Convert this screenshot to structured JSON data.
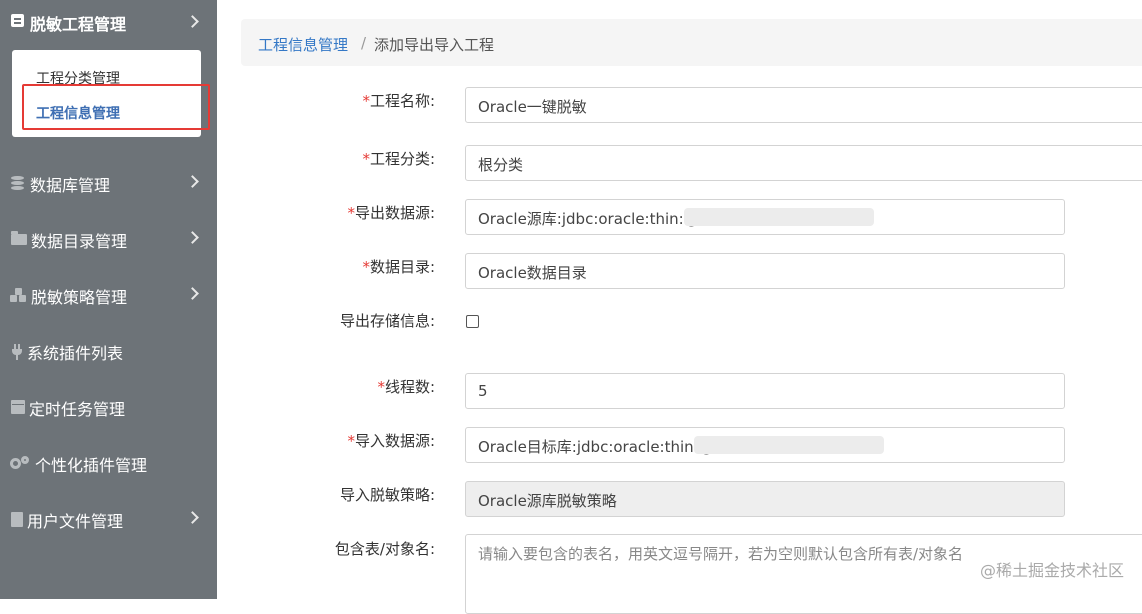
{
  "sidebar": {
    "header": {
      "title": "脱敏工程管理",
      "icon": "doc-icon"
    },
    "submenu": [
      {
        "label": "工程分类管理"
      },
      {
        "label": "工程信息管理",
        "active": true
      }
    ],
    "items": [
      {
        "label": "数据库管理",
        "icon": "database-icon",
        "has_arrow": true
      },
      {
        "label": "数据目录管理",
        "icon": "folder-icon",
        "has_arrow": true
      },
      {
        "label": "脱敏策略管理",
        "icon": "cubes-icon",
        "has_arrow": true
      },
      {
        "label": "系统插件列表",
        "icon": "plug-icon",
        "has_arrow": false
      },
      {
        "label": "定时任务管理",
        "icon": "calendar-icon",
        "has_arrow": false
      },
      {
        "label": "个性化插件管理",
        "icon": "cogs-icon",
        "has_arrow": false
      },
      {
        "label": "用户文件管理",
        "icon": "file-icon",
        "has_arrow": true
      }
    ]
  },
  "breadcrumb": {
    "parent": "工程信息管理",
    "separator": "/",
    "current": "添加导出导入工程"
  },
  "form": {
    "required_mark": "*",
    "project_name": {
      "label": "工程名称:",
      "value": "Oracle一键脱敏"
    },
    "project_category": {
      "label": "工程分类:",
      "value": "根分类"
    },
    "export_source": {
      "label": "导出数据源:",
      "value": "Oracle源库:jdbc:oracle:thin:@"
    },
    "data_directory": {
      "label": "数据目录:",
      "value": "Oracle数据目录"
    },
    "export_storage": {
      "label": "导出存储信息:",
      "checked": false
    },
    "thread_count": {
      "label": "线程数:",
      "value": "5"
    },
    "import_source": {
      "label": "导入数据源:",
      "value": "Oracle目标库:jdbc:oracle:thin:@"
    },
    "import_policy": {
      "label": "导入脱敏策略:",
      "value": "Oracle源库脱敏策略"
    },
    "include_tables": {
      "label": "包含表/对象名:",
      "placeholder": "请输入要包含的表名，用英文逗号隔开，若为空则默认包含所有表/对象名"
    }
  },
  "watermark": "@稀土掘金技术社区",
  "colors": {
    "sidebar_bg": "#6d7378",
    "link": "#3478c6",
    "required": "#e53a35",
    "highlight_border": "#e53a35"
  }
}
